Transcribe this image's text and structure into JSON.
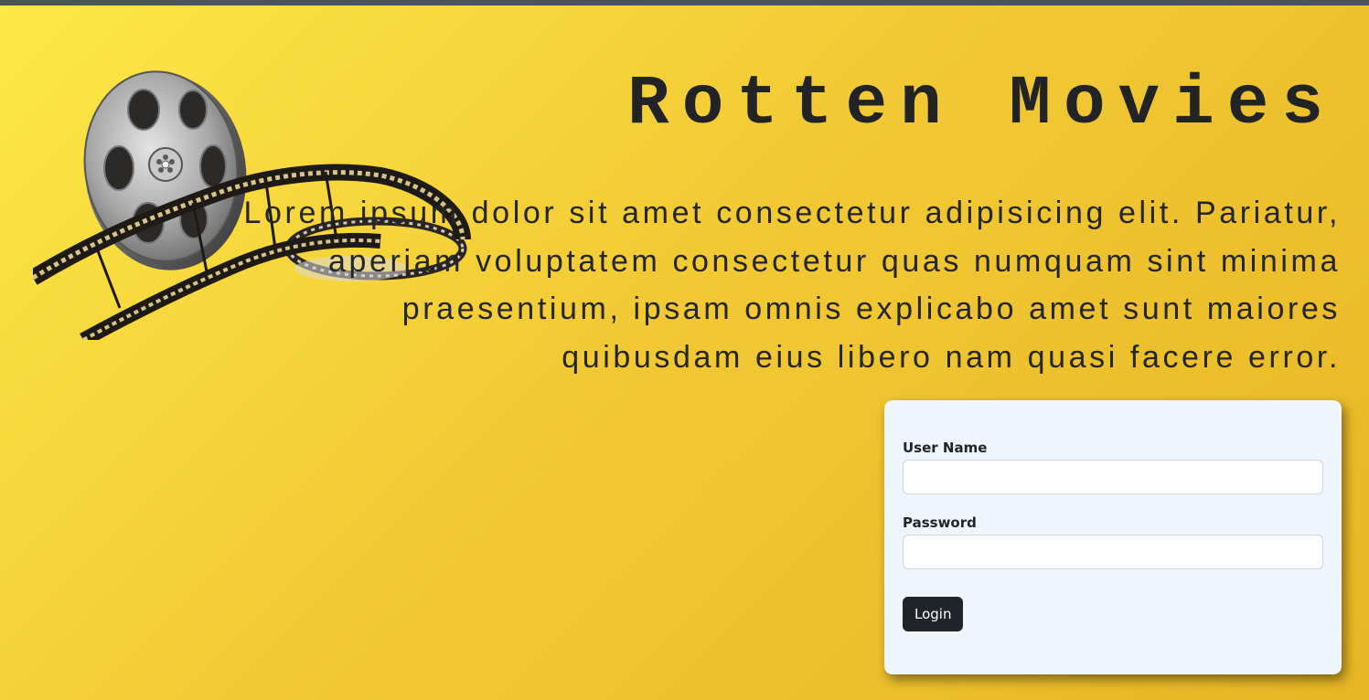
{
  "header": {
    "title": "Rotten Movies",
    "description": "Lorem ipsum dolor sit amet consectetur adipisicing elit. Pariatur, aperiam voluptatem consectetur quas numquam sint minima praesentium, ipsam omnis explicabo amet sunt maiores quibusdam eius libero nam quasi facere error."
  },
  "logo": {
    "icon": "film-reel-icon"
  },
  "login_form": {
    "username_label": "User Name",
    "username_value": "",
    "password_label": "Password",
    "password_value": "",
    "submit_label": "Login"
  },
  "colors": {
    "background_start": "#fde845",
    "background_end": "#e7b625",
    "top_bar": "#4b5459",
    "card_background": "#eef5fc",
    "button_background": "#212529",
    "text": "#222325"
  }
}
